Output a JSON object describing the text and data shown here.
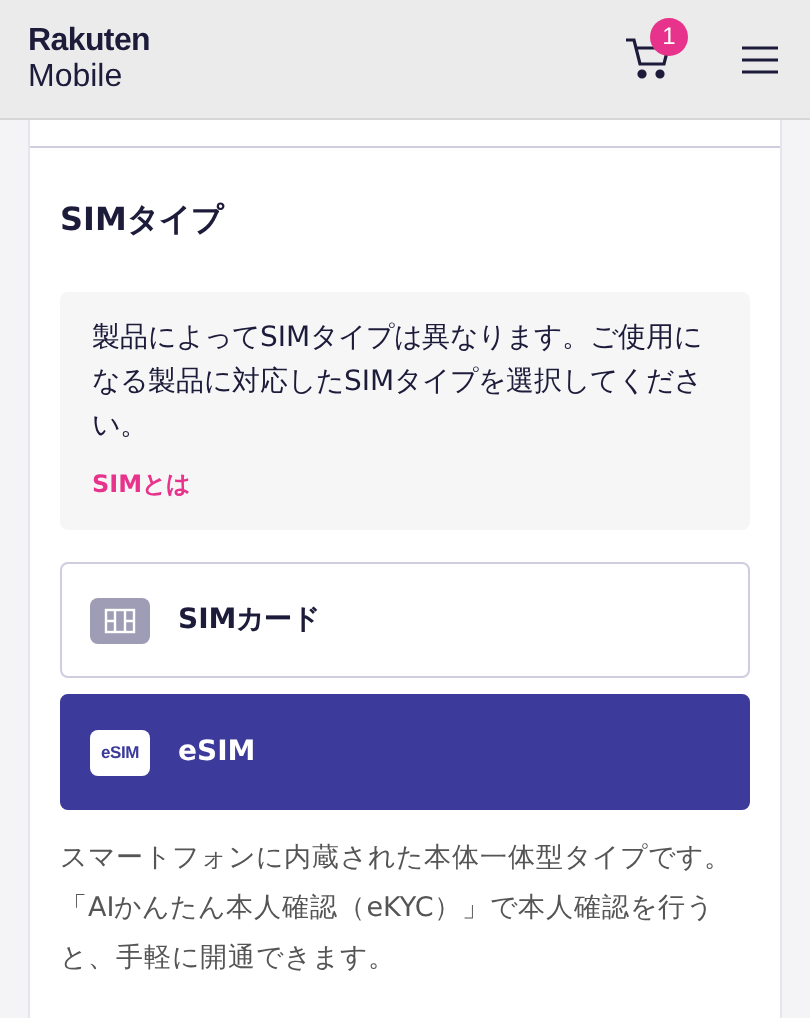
{
  "header": {
    "logo_top": "Rakuten",
    "logo_bottom": "Mobile",
    "cart_count": "1"
  },
  "section": {
    "title": "SIMタイプ",
    "info": {
      "text": "製品によってSIMタイプは異なります。ご使用になる製品に対応したSIMタイプを選択してください。",
      "link": "SIMとは"
    },
    "options": [
      {
        "kind": "sim-card",
        "label": "SIMカード",
        "selected": false
      },
      {
        "kind": "esim",
        "icon_label": "eSIM",
        "label": "eSIM",
        "selected": true
      }
    ],
    "description": "スマートフォンに内蔵された本体一体型タイプです。「AIかんたん本人確認（eKYC）」で本人確認を行うと、手軽に開通できます。"
  }
}
